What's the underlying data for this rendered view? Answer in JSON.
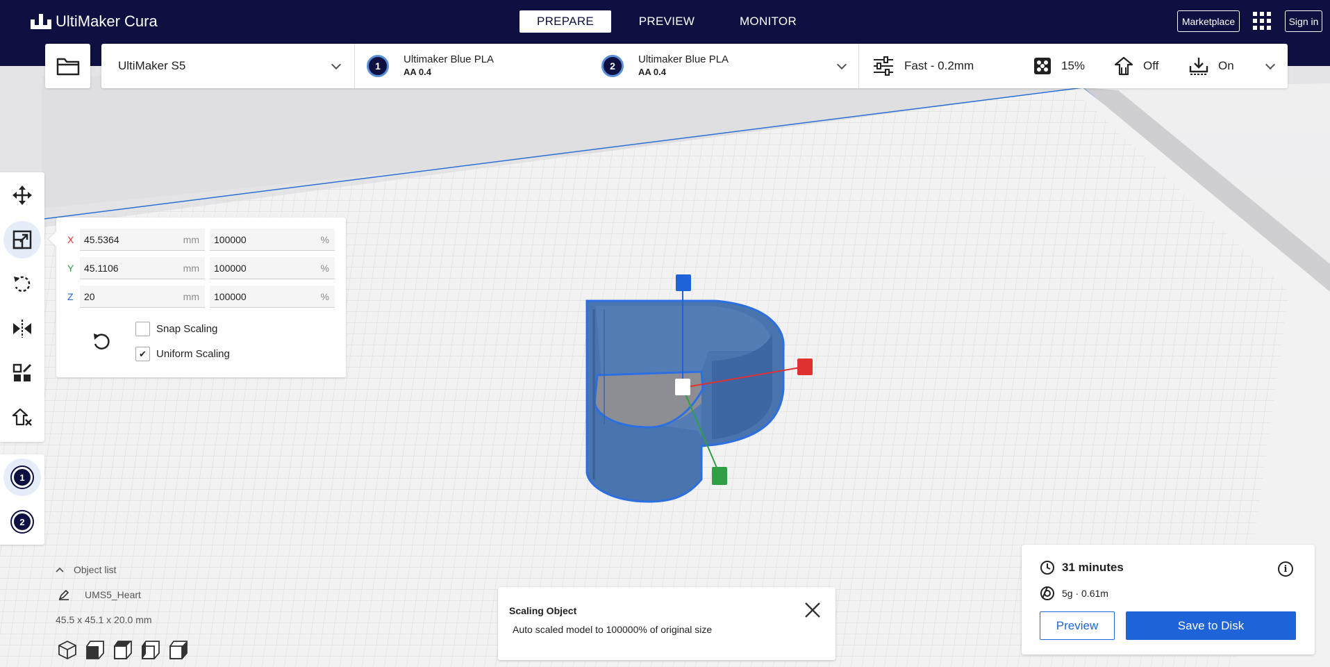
{
  "app": {
    "title": "UltiMaker Cura"
  },
  "stages": [
    {
      "label": "PREPARE",
      "active": true
    },
    {
      "label": "PREVIEW",
      "active": false
    },
    {
      "label": "MONITOR",
      "active": false
    }
  ],
  "header": {
    "marketplace": "Marketplace",
    "signin": "Sign in",
    "apps_icon": "apps-grid-icon"
  },
  "printer": {
    "name": "UltiMaker S5"
  },
  "extruders": [
    {
      "number": "1",
      "material": "Ultimaker Blue PLA",
      "nozzle": "AA 0.4"
    },
    {
      "number": "2",
      "material": "Ultimaker Blue PLA",
      "nozzle": "AA 0.4"
    }
  ],
  "print_settings": {
    "profile": "Fast - 0.2mm",
    "infill": "15%",
    "support": "Off",
    "adhesion": "On"
  },
  "scale": {
    "x": {
      "label": "X",
      "value": "45.5364",
      "unit": "mm",
      "percent": "100000",
      "pct_unit": "%",
      "color": "#e03131"
    },
    "y": {
      "label": "Y",
      "value": "45.1106",
      "unit": "mm",
      "percent": "100000",
      "pct_unit": "%",
      "color": "#2f9e44"
    },
    "z": {
      "label": "Z",
      "value": "20",
      "unit": "mm",
      "percent": "100000",
      "pct_unit": "%",
      "color": "#1e64d8"
    },
    "snap_scaling": {
      "label": "Snap Scaling",
      "checked": false
    },
    "uniform_scaling": {
      "label": "Uniform Scaling",
      "checked": true,
      "mark": "✔"
    }
  },
  "object_list": {
    "header": "Object list",
    "object_name": "UMS5_Heart",
    "dimensions": "45.5 x 45.1 x 20.0 mm"
  },
  "message": {
    "title": "Scaling Object",
    "body": "Auto scaled model to 100000% of original size"
  },
  "print_info": {
    "time": "31 minutes",
    "material": "5g · 0.61m",
    "preview_label": "Preview",
    "save_label": "Save to Disk"
  },
  "colors": {
    "header_bg": "#0e1041",
    "accent": "#1e64d8",
    "model": "#4a74ad"
  }
}
